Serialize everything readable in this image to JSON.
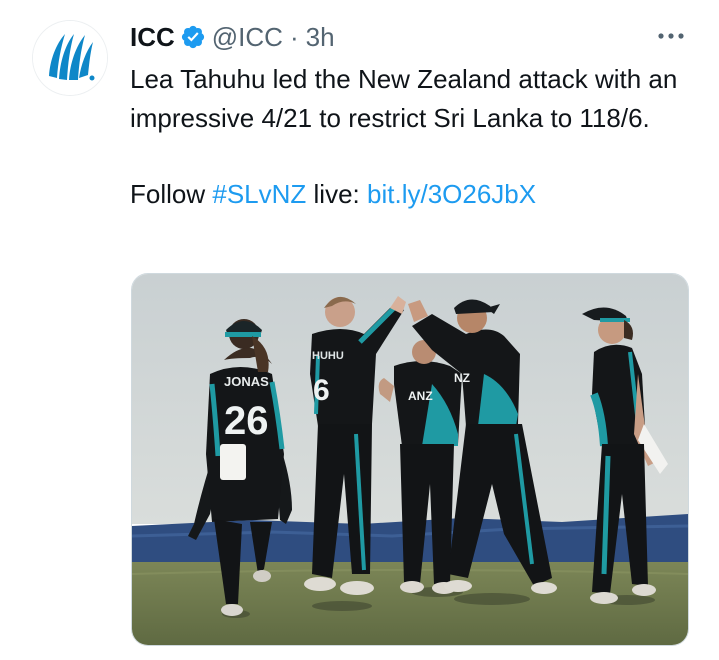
{
  "tweet": {
    "author": {
      "name": "ICC",
      "handle": "@ICC",
      "separator": "·",
      "time": "3h",
      "avatar_icon": "icc-logo-icon",
      "verified_icon": "verified-badge-icon"
    },
    "more_icon": "more-options-icon",
    "text": {
      "line_main": "Lea Tahuhu led the New Zealand attack with an impressive 4/21 to restrict Sri Lanka to 118/6.",
      "follow_word": "Follow",
      "hashtag": "#SLvNZ",
      "live_word": "live:",
      "link": "bit.ly/3O26JbX"
    },
    "media": {
      "jersey_names": [
        "JONAS",
        "HUHU",
        "ANZ",
        "NZ"
      ],
      "jersey_number": "26",
      "jersey_number_2": "6",
      "colors": {
        "kit_black": "#141618",
        "kit_teal": "#1f9aa3",
        "sky": "#cfd6d8",
        "covers": "#2c4a7c",
        "grass": "#6f7a4e"
      }
    }
  }
}
